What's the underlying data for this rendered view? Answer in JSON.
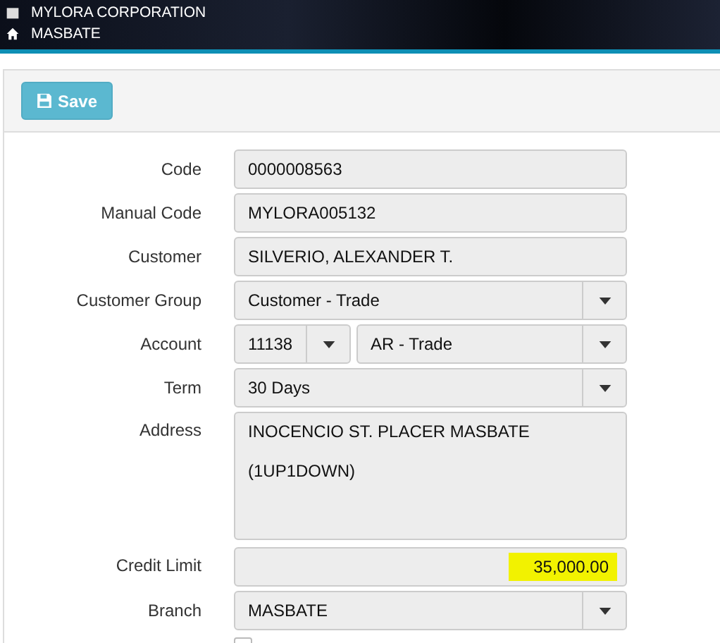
{
  "header": {
    "company": "MYLORA CORPORATION",
    "branch": "MASBATE"
  },
  "toolbar": {
    "save_button": "Save"
  },
  "form": [
    {
      "kind": "text",
      "label": "Code",
      "value": "0000008563"
    },
    {
      "kind": "text",
      "label": "Manual Code",
      "value": "MYLORA005132"
    },
    {
      "kind": "text",
      "label": "Customer",
      "value": "SILVERIO, ALEXANDER T."
    },
    {
      "kind": "select",
      "label": "Customer Group",
      "value": "Customer - Trade"
    },
    {
      "kind": "pair",
      "label": "Account",
      "value": "11138",
      "value_2": "AR - Trade"
    },
    {
      "kind": "select",
      "label": "Term",
      "value": "30 Days"
    },
    {
      "kind": "area",
      "label": "Address",
      "lines": [
        "INOCENCIO ST. PLACER MASBATE",
        "(1UP1DOWN)"
      ]
    },
    {
      "kind": "amount",
      "label": "Credit Limit",
      "value": "35,000.00"
    },
    {
      "kind": "select",
      "label": "Branch",
      "value": "MASBATE"
    }
  ],
  "checkbox": {
    "checked": false
  }
}
